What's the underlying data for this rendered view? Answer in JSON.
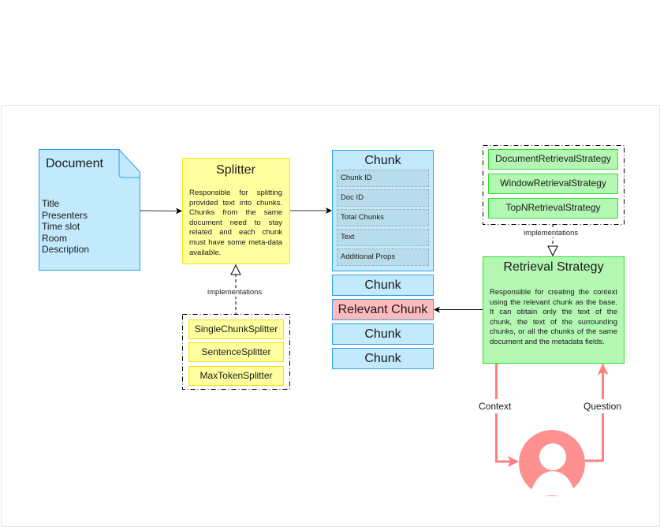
{
  "document": {
    "title": "Document",
    "fields": [
      "Title",
      "Presenters",
      "Time slot",
      "Room",
      "Description"
    ]
  },
  "splitter": {
    "title": "Splitter",
    "description": "Responsible for splitting provided text into chunks. Chunks from the same document need to stay related and each chunk must have some meta-data available.",
    "implementations_label": "implementations",
    "implementations": [
      "SingleChunkSplitter",
      "SentenceSplitter",
      "MaxTokenSplitter"
    ]
  },
  "chunk": {
    "title": "Chunk",
    "fields": [
      "Chunk ID",
      "Doc ID",
      "Total Chunks",
      "Text",
      "Additional Props"
    ],
    "list": [
      "Chunk",
      "Relevant Chunk",
      "Chunk",
      "Chunk"
    ]
  },
  "retrieval": {
    "title": "Retrieval Strategy",
    "description": "Responsible for creating the context using the relevant chunk as the base. It can obtain only the text of the chunk, the text of the surrounding chunks, or all the chunks of the same document and the metadata fields.",
    "implementations_label": "implementations",
    "implementations": [
      "DocumentRetrievalStrategy",
      "WindowRetrievalStrategy",
      "TopNRetrievalStrategy"
    ]
  },
  "user_flow": {
    "context_label": "Context",
    "question_label": "Question"
  },
  "colors": {
    "blue_fill": "#c2e9fc",
    "blue_stroke": "#2d9ee8",
    "yellow_fill": "#ffff9f",
    "green_fill": "#b3f7b3",
    "relevant_fill": "#ffbbbb",
    "user_flow": "#ff8080"
  }
}
